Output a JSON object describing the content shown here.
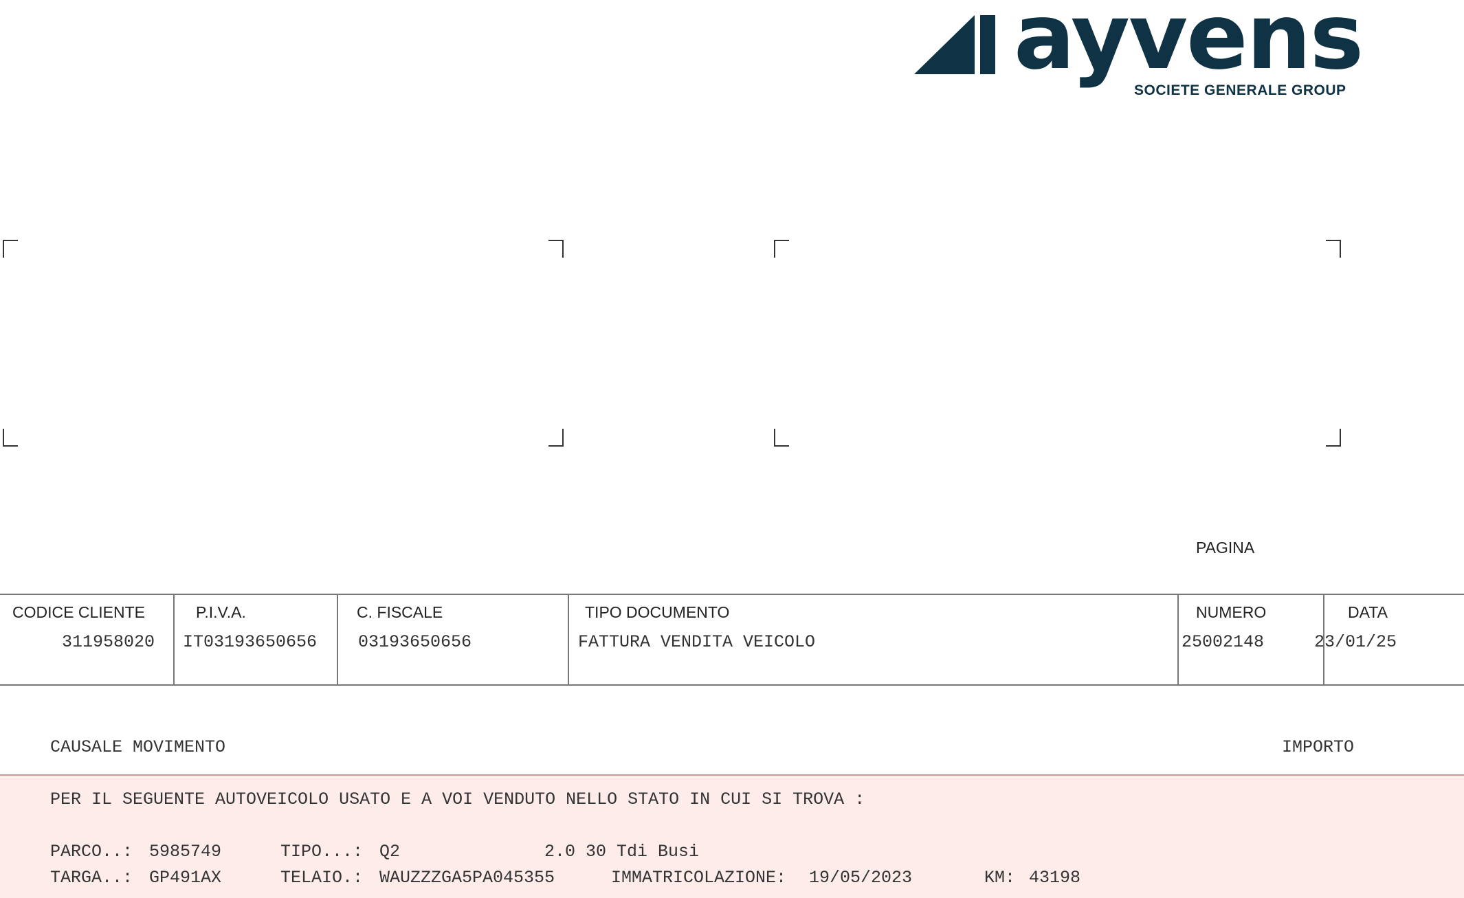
{
  "logo": {
    "wordmark": "ayvens",
    "tagline": "SOCIETE GENERALE GROUP",
    "color": "#0f3344"
  },
  "page_label": "PAGINA",
  "header": {
    "codice_cliente": {
      "label": "CODICE CLIENTE",
      "value": "311958020"
    },
    "piva": {
      "label": "P.I.V.A.",
      "value": "IT03193650656"
    },
    "codice_fiscale": {
      "label": "C. FISCALE",
      "value": "03193650656"
    },
    "tipo_documento": {
      "label": "TIPO DOCUMENTO",
      "value": "FATTURA VENDITA VEICOLO"
    },
    "numero": {
      "label": "NUMERO",
      "value": "25002148"
    },
    "data": {
      "label": "DATA",
      "value": "23/01/25"
    }
  },
  "columns": {
    "causale": "CAUSALE MOVIMENTO",
    "importo": "IMPORTO"
  },
  "body": {
    "intro": "PER IL SEGUENTE AUTOVEICOLO USATO E A VOI VENDUTO NELLO STATO IN CUI SI TROVA :",
    "parco_label": "PARCO..:",
    "parco_value": "5985749",
    "tipo_label": "TIPO...:",
    "tipo_value": "Q2",
    "tipo_desc": "2.0 30 Tdi Busi",
    "targa_label": "TARGA..:",
    "targa_value": "GP491AX",
    "telaio_label": "TELAIO.:",
    "telaio_value": "WAUZZZGA5PA045355",
    "immatricolazione_label": "IMMATRICOLAZIONE:",
    "immatricolazione_value": "19/05/2023",
    "km_label": "KM:",
    "km_value": "43198",
    "band_color": "#fdecea"
  }
}
